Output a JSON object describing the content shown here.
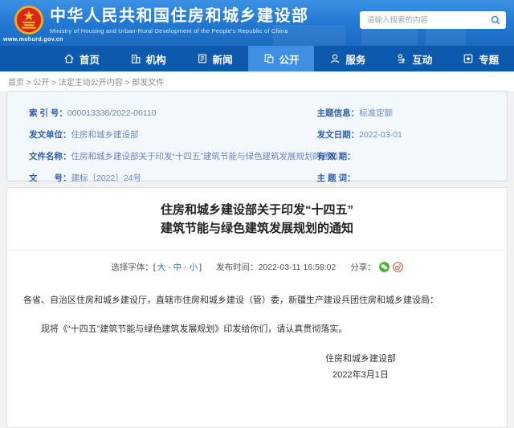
{
  "header": {
    "site_title": "中华人民共和国住房和城乡建设部",
    "site_subtitle": "Ministry of Housing and Urban-Rural Development of the People's Republic of China",
    "site_url": "www.mohurd.gov.cn",
    "search_placeholder": "请输入搜索的内容"
  },
  "nav": {
    "items": [
      {
        "label": "首页"
      },
      {
        "label": "机构"
      },
      {
        "label": "新闻"
      },
      {
        "label": "公开"
      },
      {
        "label": "服务"
      },
      {
        "label": "互动"
      },
      {
        "label": "专题"
      }
    ]
  },
  "breadcrumb": {
    "path": "首页 > 公开 > 法定主动公开内容 > 部发文件"
  },
  "meta_panel": {
    "left": [
      {
        "label": "索 引 号：",
        "value": "000013338/2022-00110"
      },
      {
        "label": "发文单位：",
        "value": "住房和城乡建设部"
      },
      {
        "label": "文件名称：",
        "value": "住房和城乡建设部关于印发“十四五”建筑节能与绿色建筑发展规划的通知"
      },
      {
        "label": "文　　号：",
        "value": "建标〔2022〕24号"
      }
    ],
    "right": [
      {
        "label": "主题信息：",
        "value": "标准定额"
      },
      {
        "label": "发文日期：",
        "value": "2022-03-01"
      },
      {
        "label": "有 效 期：",
        "value": ""
      },
      {
        "label": "主 题 词：",
        "value": ""
      }
    ]
  },
  "article": {
    "title_line1": "住房和城乡建设部关于印发“十四五”",
    "title_line2": "建筑节能与绿色建筑发展规划的通知",
    "font_select_label": "选择字体：",
    "bracket_open": "[",
    "bracket_close": "]",
    "font_sizes": [
      "大",
      "中",
      "小"
    ],
    "font_separator": "-",
    "publish_label": "发布时间：",
    "publish_time": "2022-03-11 16:58:02",
    "share_label": "分享：",
    "paragraphs": [
      "各省、自治区住房和城乡建设厅，直辖市住房和城乡建设（管）委，新疆生产建设兵团住房和城乡建设局：",
      "现将《“十四五”建筑节能与绿色建筑发展规划》印发给你们，请认真贯彻落实。"
    ],
    "signature": "住房和城乡建设部",
    "sign_date": "2022年3月1日"
  },
  "colors": {
    "header_blue": "#2379d2",
    "nav_blue": "#0d59ad",
    "nav_active_blue": "#3f90e4",
    "panel_blue_bg": "#f3f8fd",
    "panel_blue_border": "#cdddf2",
    "label_blue": "#2f5fa8",
    "link_blue": "#2a6fc2",
    "wechat_green": "#48b338",
    "weibo_red": "#e0524e",
    "emblem_red": "#da251d",
    "emblem_gold": "#f2c31f"
  }
}
